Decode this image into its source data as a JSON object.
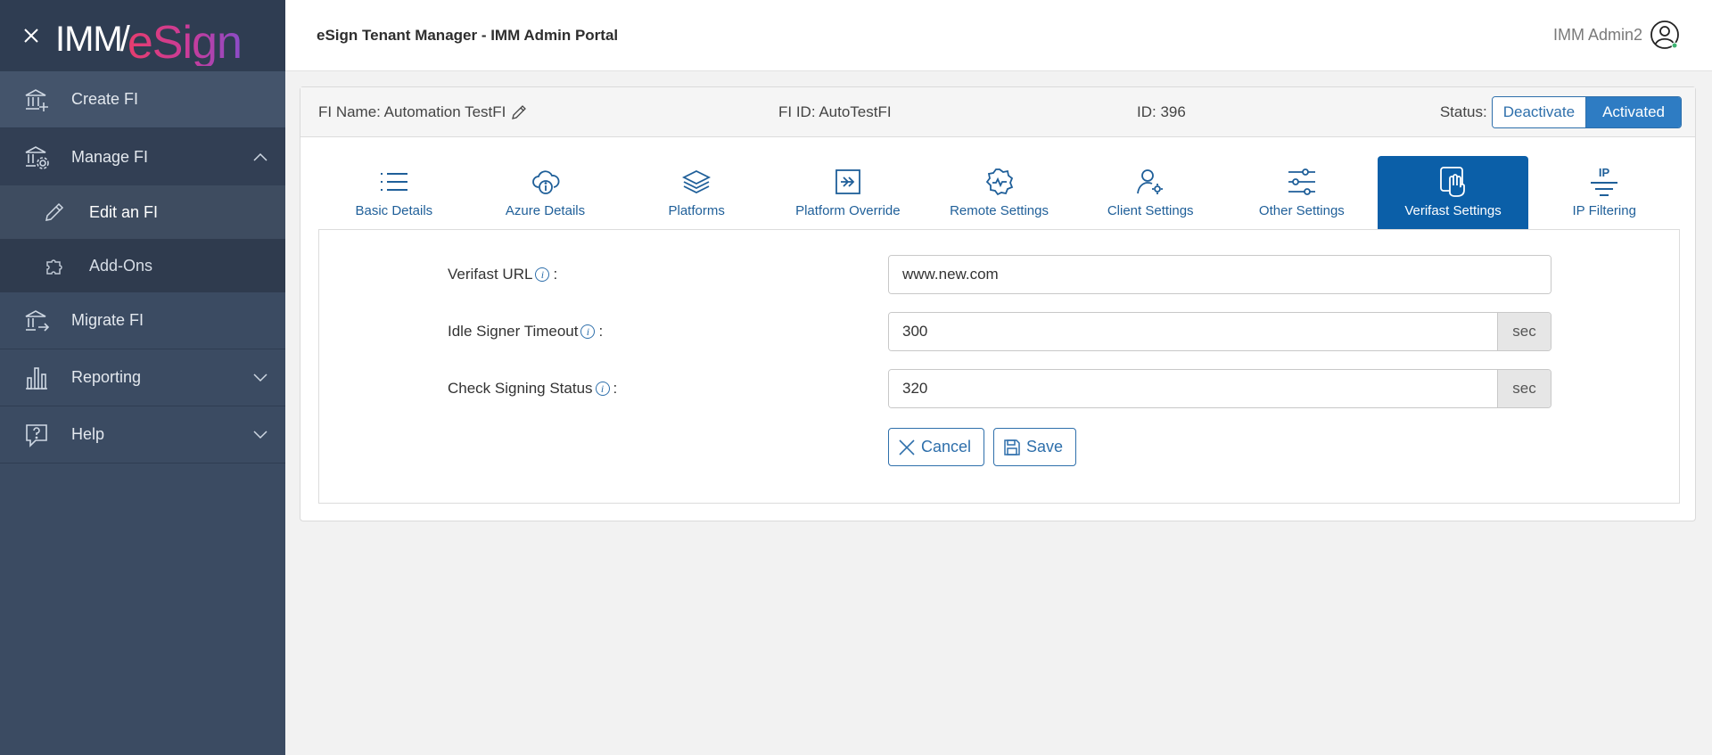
{
  "brand": {
    "logo_imm": "IMM",
    "logo_esign": "eSign"
  },
  "sidebar": {
    "items": [
      {
        "label": "Create FI",
        "icon": "bank-plus-icon"
      },
      {
        "label": "Manage FI",
        "icon": "bank-gear-icon"
      },
      {
        "label": "Edit an FI",
        "icon": "pencil-icon"
      },
      {
        "label": "Add-Ons",
        "icon": "puzzle-icon"
      },
      {
        "label": "Migrate FI",
        "icon": "bank-arrow-icon"
      },
      {
        "label": "Reporting",
        "icon": "bar-chart-icon"
      },
      {
        "label": "Help",
        "icon": "help-bubble-icon"
      }
    ]
  },
  "header": {
    "title": "eSign Tenant Manager - IMM Admin Portal",
    "user_name": "IMM Admin2"
  },
  "fi": {
    "name_text": "FI Name: Automation TestFI",
    "fi_id_text": "FI ID: AutoTestFI",
    "id_text": "ID: 396",
    "status_label": "Status:",
    "deactivate_label": "Deactivate",
    "activated_label": "Activated"
  },
  "tabs": [
    {
      "label": "Basic Details",
      "icon": "list-icon"
    },
    {
      "label": "Azure Details",
      "icon": "cloud-info-icon"
    },
    {
      "label": "Platforms",
      "icon": "layers-icon"
    },
    {
      "label": "Platform Override",
      "icon": "arrow-into-box-icon"
    },
    {
      "label": "Remote Settings",
      "icon": "badge-gear-icon"
    },
    {
      "label": "Client Settings",
      "icon": "user-gear-icon"
    },
    {
      "label": "Other Settings",
      "icon": "sliders-icon"
    },
    {
      "label": "Verifast Settings",
      "icon": "hand-touch-icon",
      "active": true
    },
    {
      "label": "IP Filtering",
      "icon": "ip-filter-icon"
    }
  ],
  "form": {
    "verifast_url": {
      "label": "Verifast URL",
      "colon": ":",
      "value": "www.new.com"
    },
    "idle_timeout": {
      "label": "Idle Signer Timeout",
      "colon": ":",
      "value": "300",
      "unit": "sec"
    },
    "check_status": {
      "label": "Check Signing Status",
      "colon": ":",
      "value": "320",
      "unit": "sec"
    },
    "cancel_label": "Cancel",
    "save_label": "Save"
  },
  "colors": {
    "sidebar": "#3b4b62",
    "accent": "#2e7cc3",
    "active_tab": "#0b5fa8"
  }
}
